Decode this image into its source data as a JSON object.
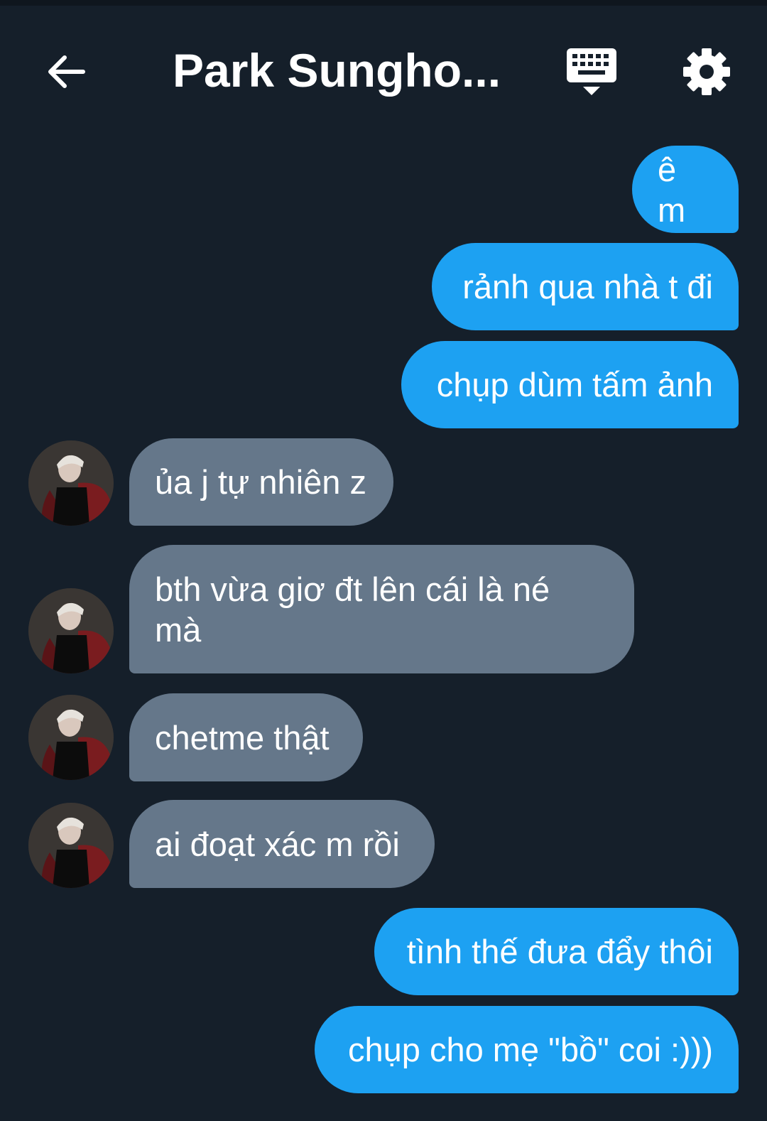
{
  "header": {
    "title": "Park Sungho...",
    "back_icon": "arrow-left-icon",
    "keyboard_icon": "keyboard-icon",
    "settings_icon": "gear-icon"
  },
  "colors": {
    "background": "#151f2a",
    "sent_bubble": "#1da1f2",
    "received_bubble": "#65778a",
    "text": "#ffffff"
  },
  "messages": [
    {
      "from": "me",
      "text": "ê m"
    },
    {
      "from": "me",
      "text": "rảnh qua nhà t đi"
    },
    {
      "from": "me",
      "text": "chụp dùm tấm ảnh"
    },
    {
      "from": "them",
      "text": "ủa j tự nhiên z"
    },
    {
      "from": "them",
      "text": "bth vừa giơ đt lên cái là né mà"
    },
    {
      "from": "them",
      "text": "chetme thật"
    },
    {
      "from": "them",
      "text": "ai đoạt xác m rồi"
    },
    {
      "from": "me",
      "text": "tình thế đưa đẩy thôi"
    },
    {
      "from": "me",
      "text": "chụp cho mẹ \"bồ\" coi :)))"
    }
  ]
}
